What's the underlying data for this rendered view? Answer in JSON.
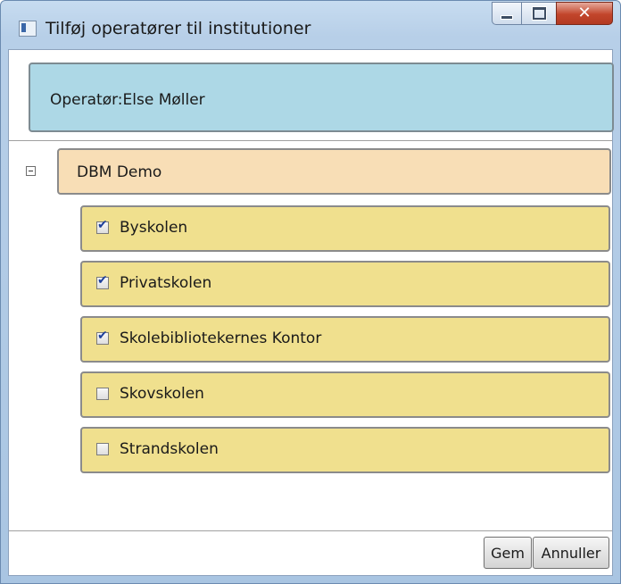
{
  "window": {
    "title": "Tilføj operatører til institutioner",
    "close_glyph": "✕"
  },
  "operator": {
    "label": "Operatør:Else Møller"
  },
  "tree": {
    "toggle_glyph": "−",
    "root_label": "DBM Demo",
    "children": [
      {
        "label": "Byskolen",
        "checked": true
      },
      {
        "label": "Privatskolen",
        "checked": true
      },
      {
        "label": "Skolebibliotekernes Kontor",
        "checked": true
      },
      {
        "label": "Skovskolen",
        "checked": false
      },
      {
        "label": "Strandskolen",
        "checked": false
      }
    ]
  },
  "buttons": {
    "save": "Gem",
    "cancel": "Annuller"
  },
  "colors": {
    "operator_bg": "#add8e6",
    "root_bg": "#f8deb6",
    "child_bg": "#f0e08e"
  }
}
